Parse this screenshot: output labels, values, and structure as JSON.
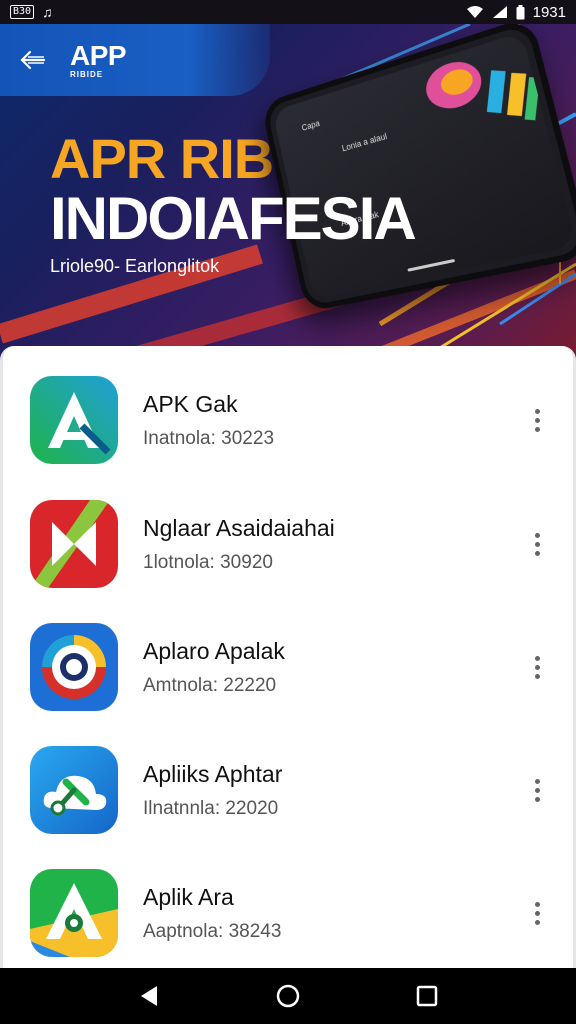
{
  "status_bar": {
    "left_badge": "B30",
    "left_glyph": "♫",
    "time": "1931"
  },
  "header": {
    "logo_main": "APP",
    "logo_sub": "RIBIDE"
  },
  "hero": {
    "headline_1": "APR RIB",
    "headline_2": "INDOIAFESIA",
    "tagline": "Lriole90- Earlonglitok",
    "phone_texts": [
      "Capa",
      "Lonia a alaul",
      "Abora alak"
    ]
  },
  "apps": [
    {
      "name": "APK Gak",
      "meta": "Inatnola: 30223",
      "icon": "a-green-blue-icon"
    },
    {
      "name": "Nglaar Asaidaiahai",
      "meta": "1lotnola: 30920",
      "icon": "red-play-icon"
    },
    {
      "name": "Aplaro Apalak",
      "meta": "Amtnola: 22220",
      "icon": "camera-ring-icon"
    },
    {
      "name": "Apliiks Aphtar",
      "meta": "Ilnatnnla: 22020",
      "icon": "cloud-tool-icon"
    },
    {
      "name": "Aplik Ara",
      "meta": "Aaptnola: 38243",
      "icon": "a-green-yellow-icon"
    }
  ],
  "colors": {
    "accent_orange": "#f7a623",
    "header_blue": "#1354b8"
  }
}
